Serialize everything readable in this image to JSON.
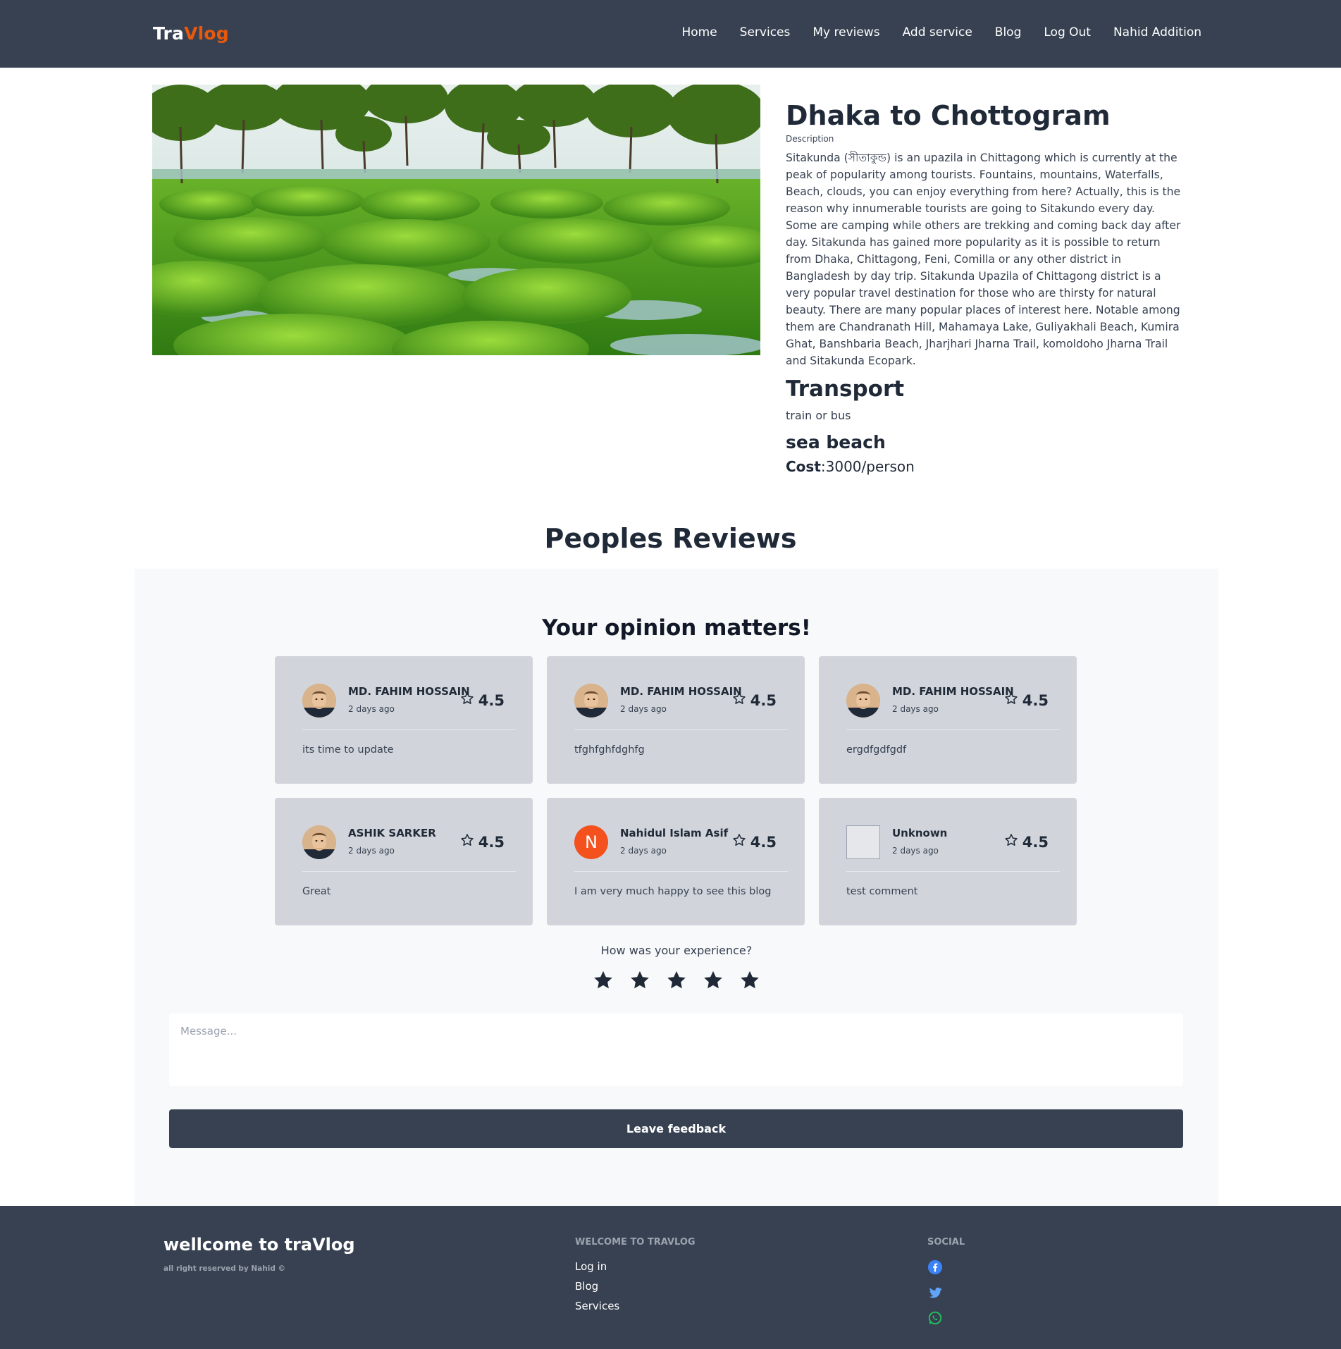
{
  "nav": {
    "logo_part1": "Tra",
    "logo_part2": "Vlog",
    "links": [
      "Home",
      "Services",
      "My reviews",
      "Add service",
      "Blog",
      "Log Out",
      "Nahid Addition"
    ]
  },
  "service": {
    "title": "Dhaka to Chottogram",
    "description_label": "Description",
    "description": "Sitakunda (সীতাকুন্ড) is an upazila in Chittagong which is currently at the peak of popularity among tourists. Fountains, mountains, Waterfalls, Beach, clouds, you can enjoy everything from here? Actually, this is the reason why innumerable tourists are going to Sitakundo every day. Some are camping while others are trekking and coming back day after day. Sitakunda has gained more popularity as it is possible to return from Dhaka, Chittagong, Feni, Comilla or any other district in Bangladesh by day trip. Sitakunda Upazila of Chittagong district is a very popular travel destination for those who are thirsty for natural beauty. There are many popular places of interest here. Notable among them are Chandranath Hill, Mahamaya Lake, Guliyakhali Beach, Kumira Ghat, Banshbaria Beach, Jharjhari Jharna Trail, komoldoho Jharna Trail and Sitakunda Ecopark.",
    "transport_heading": "Transport",
    "transport_value": "train or bus",
    "category": "sea beach",
    "cost_label": "Cost",
    "cost_value": ":3000/person"
  },
  "reviews": {
    "title": "Peoples Reviews",
    "subtitle": "Your opinion matters!",
    "items": [
      {
        "name": "MD. FAHIM HOSSAIN",
        "time": "2 days ago",
        "rating": "4.5",
        "comment": "its time to update",
        "avatar": "photo"
      },
      {
        "name": "MD. FAHIM HOSSAIN",
        "time": "2 days ago",
        "rating": "4.5",
        "comment": "tfghfghfdghfg",
        "avatar": "photo"
      },
      {
        "name": "MD. FAHIM HOSSAIN",
        "time": "2 days ago",
        "rating": "4.5",
        "comment": "ergdfgdfgdf",
        "avatar": "photo"
      },
      {
        "name": "ASHIK SARKER",
        "time": "2 days ago",
        "rating": "4.5",
        "comment": "Great",
        "avatar": "photo"
      },
      {
        "name": "Nahidul Islam Asif",
        "time": "2 days ago",
        "rating": "4.5",
        "comment": "I am very much happy to see this blog",
        "avatar": "N"
      },
      {
        "name": "Unknown",
        "time": "2 days ago",
        "rating": "4.5",
        "comment": "test comment",
        "avatar": "broken"
      }
    ],
    "experience_question": "How was your experience?",
    "star_count": 5,
    "message_placeholder": "Message...",
    "submit_label": "Leave feedback"
  },
  "footer": {
    "brand": "wellcome to traVlog",
    "rights": "all right reserved by Nahid ©",
    "links_title": "WELCOME TO TRAVLOG",
    "links": [
      "Log in",
      "Blog",
      "Services"
    ],
    "social_title": "SOCIAL",
    "social_icons": [
      "facebook-icon",
      "twitter-icon",
      "whatsapp-icon"
    ]
  },
  "colors": {
    "navbar": "#374151",
    "accent": "#ea580c",
    "card": "#d1d5db",
    "facebook": "#3b82f6",
    "twitter": "#60a5fa",
    "whatsapp": "#22c55e"
  }
}
